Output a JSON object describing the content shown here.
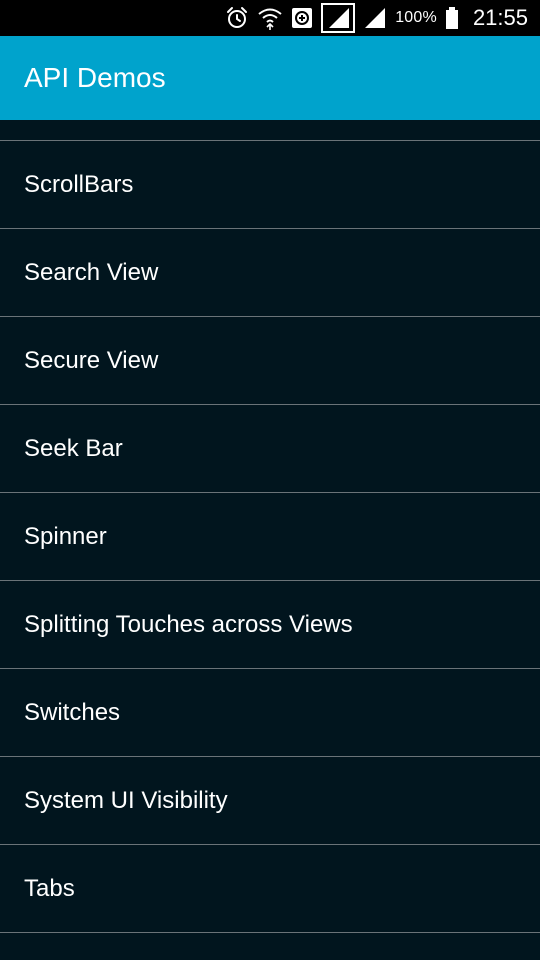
{
  "status_bar": {
    "icons": [
      "alarm-icon",
      "wifi-icon",
      "data-saver-icon",
      "signal-sim1-icon",
      "signal-sim2-icon",
      "battery-icon"
    ],
    "battery": "100%",
    "time": "21:55"
  },
  "app_bar": {
    "title": "API Demos",
    "color": "#00a3cc"
  },
  "list": {
    "background": "#01151e",
    "items": [
      {
        "label": "ScrollBars"
      },
      {
        "label": "Search View"
      },
      {
        "label": "Secure View"
      },
      {
        "label": "Seek Bar"
      },
      {
        "label": "Spinner"
      },
      {
        "label": "Splitting Touches across Views"
      },
      {
        "label": "Switches"
      },
      {
        "label": "System UI Visibility"
      },
      {
        "label": "Tabs"
      }
    ]
  }
}
